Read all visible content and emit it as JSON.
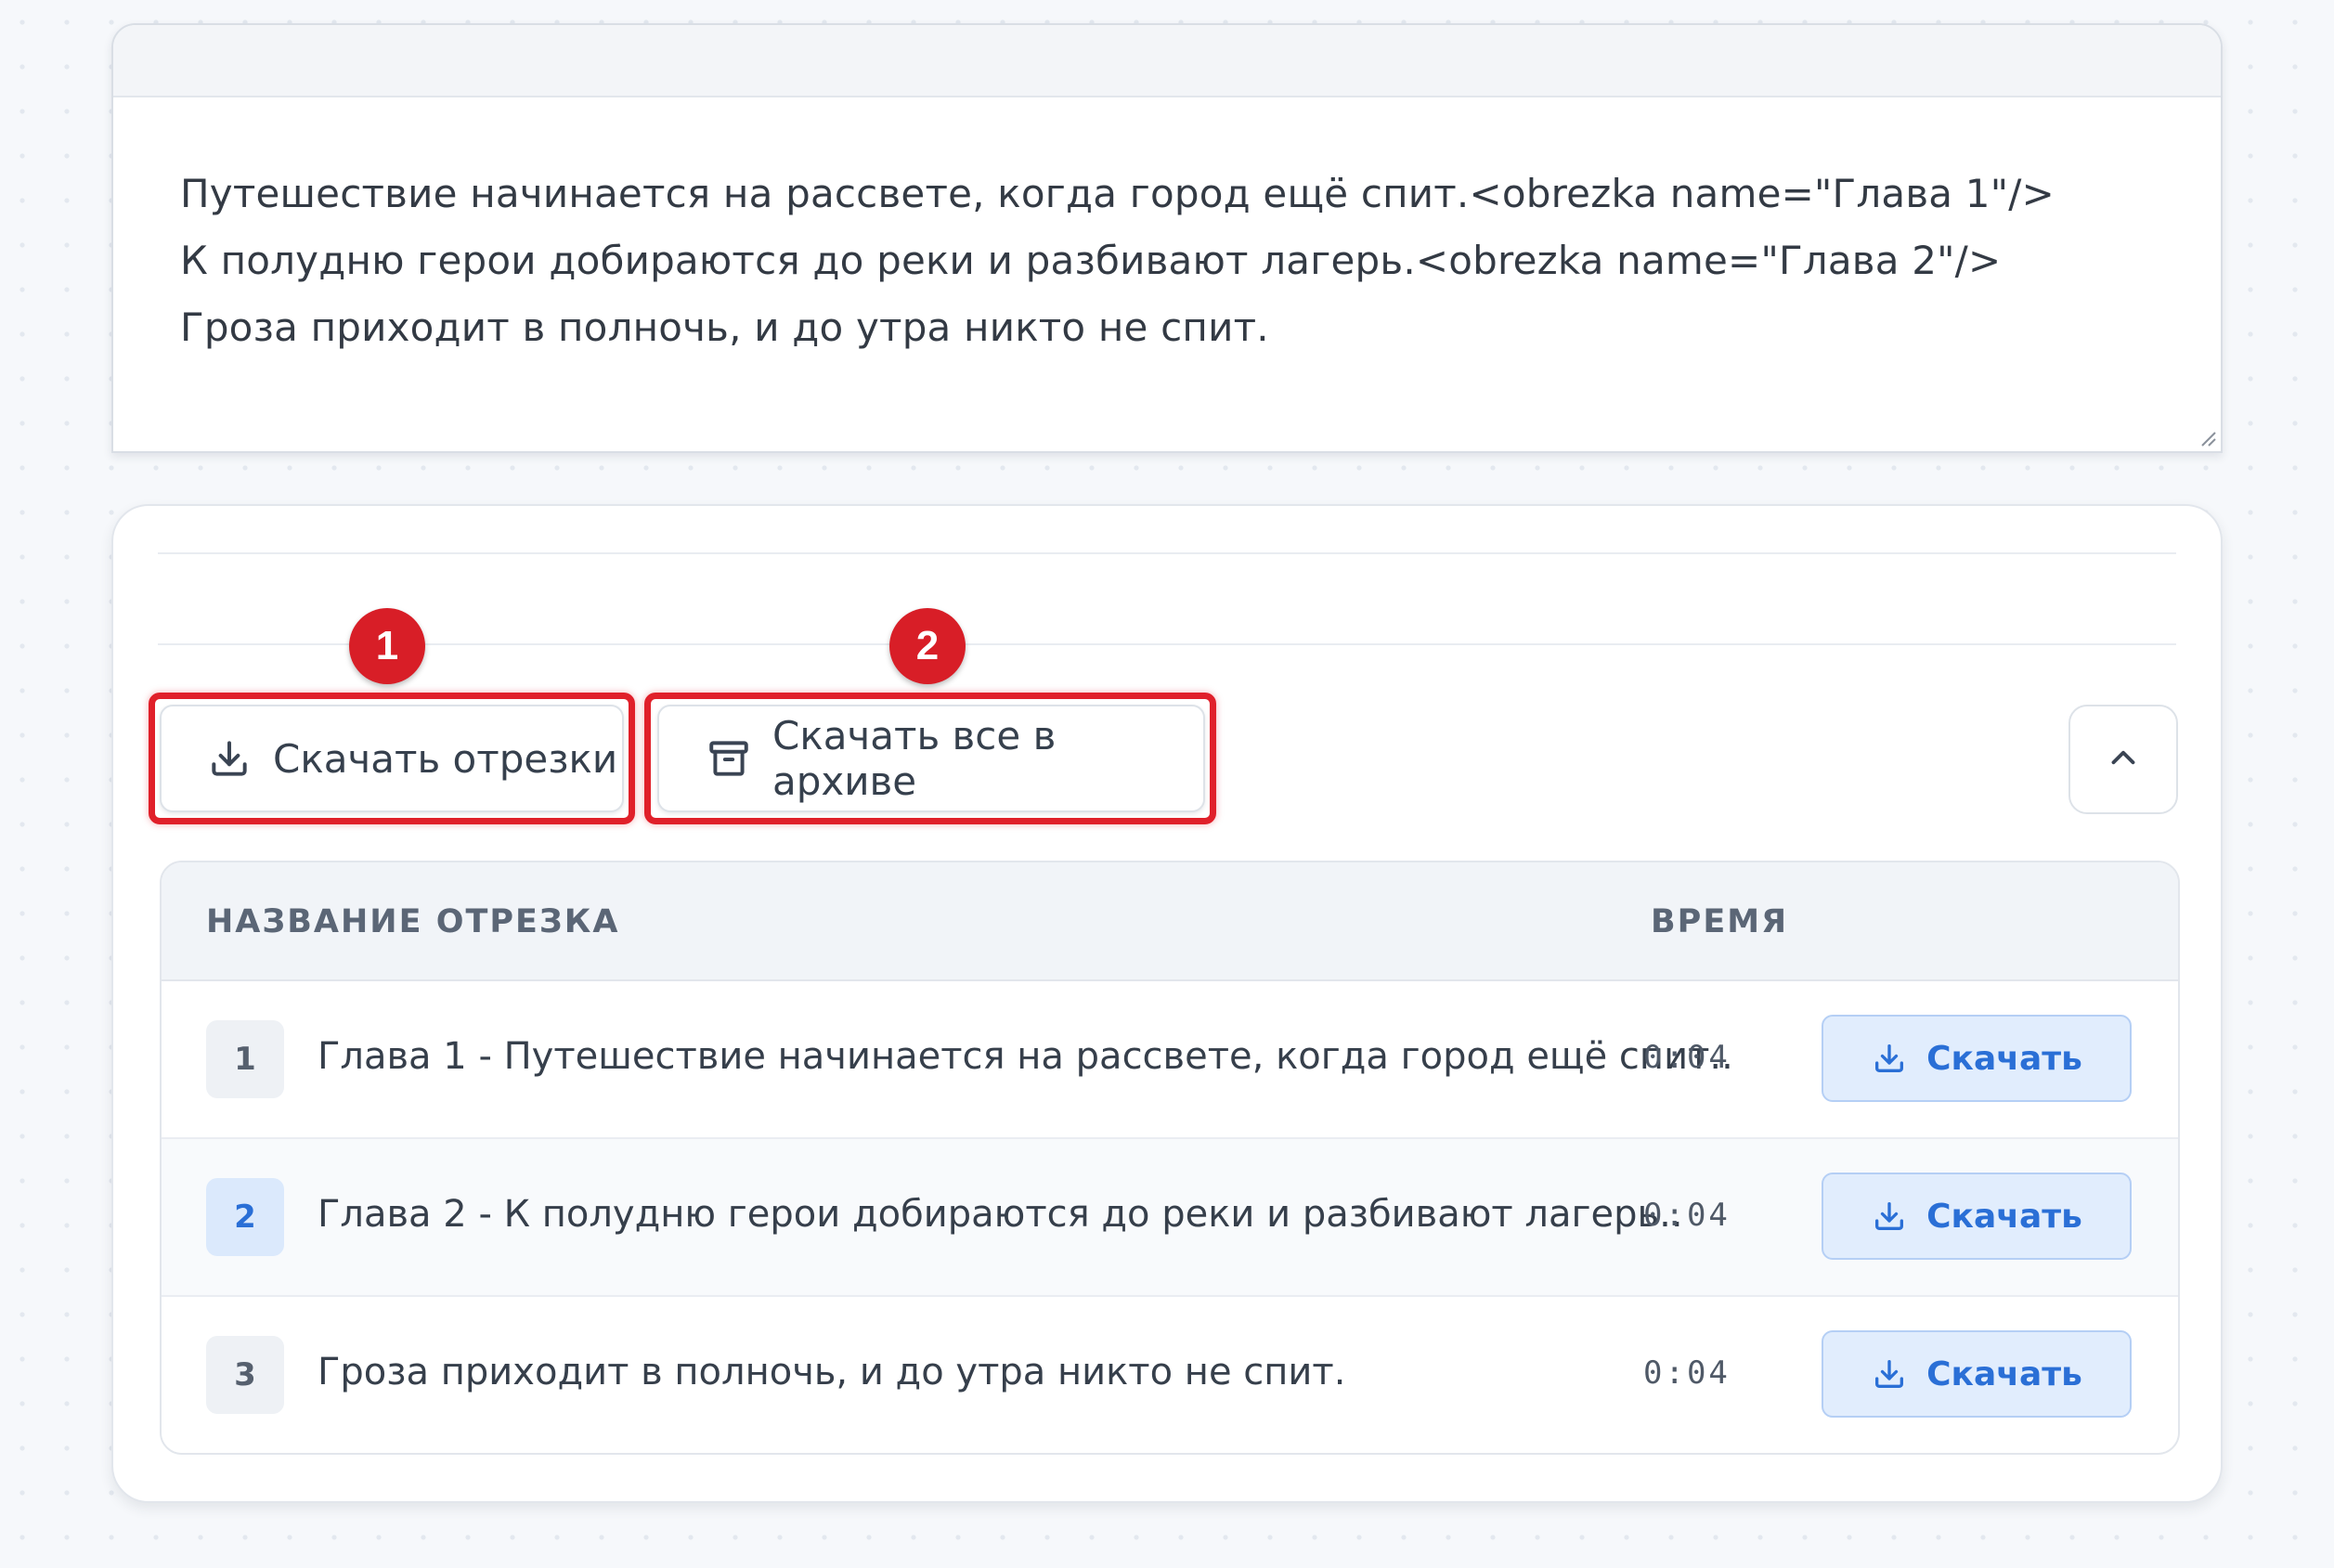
{
  "editor": {
    "lines": [
      "Путешествие начинается на рассвете, когда город ещё спит.<obrezka name=\"Глава 1\"/>",
      "К полудню герои добираются до реки и разбивают лагерь.<obrezka name=\"Глава 2\"/>",
      "Гроза приходит в полночь, и до утра никто не спит."
    ]
  },
  "actions": {
    "download_parts_label": "Скачать отрезки",
    "download_archive_label": "Скачать все в архиве"
  },
  "callouts": {
    "first": "1",
    "second": "2"
  },
  "table": {
    "columns": {
      "name": "НАЗВАНИЕ ОТРЕЗКА",
      "time": "ВРЕМЯ"
    },
    "rows": [
      {
        "index": "1",
        "title": "Глава 1 - Путешествие начинается на рассвете, когда город ещё спит..",
        "time": "0:04",
        "button": "Скачать"
      },
      {
        "index": "2",
        "title": "Глава 2 - К полудню герои добираются до реки и разбивают лагерь..",
        "time": "0:04",
        "button": "Скачать"
      },
      {
        "index": "3",
        "title": "Гроза приходит в полночь, и до утра никто не спит.",
        "time": "0:04",
        "button": "Скачать"
      }
    ]
  },
  "icons": {
    "download": "download-icon",
    "archive": "archive-icon",
    "collapse": "chevron-up-icon",
    "resize": "resize-handle-icon"
  },
  "colors": {
    "accent": "#2a6fd6",
    "callout": "#d81e27"
  }
}
